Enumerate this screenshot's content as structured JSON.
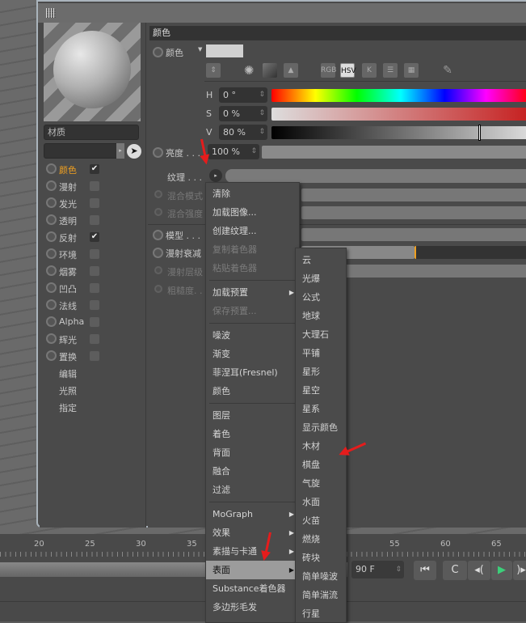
{
  "preview": {
    "material_name": "材质"
  },
  "channels": [
    {
      "label": "颜色",
      "checked": true,
      "active": true
    },
    {
      "label": "漫射",
      "checked": false
    },
    {
      "label": "发光",
      "checked": false
    },
    {
      "label": "透明",
      "checked": false
    },
    {
      "label": "反射",
      "checked": true
    },
    {
      "label": "环境",
      "checked": false
    },
    {
      "label": "烟雾",
      "checked": false
    },
    {
      "label": "凹凸",
      "checked": false
    },
    {
      "label": "法线",
      "checked": false
    },
    {
      "label": "Alpha",
      "checked": false
    },
    {
      "label": "辉光",
      "checked": false
    },
    {
      "label": "置换",
      "checked": false
    }
  ],
  "extra_items": [
    "编辑",
    "光照",
    "指定"
  ],
  "section_title": "颜色",
  "color": {
    "label": "颜色",
    "swatch": "#d0d0d0",
    "mode_buttons": [
      "RGB",
      "HSV",
      "K"
    ],
    "active_mode": "HSV",
    "h_label": "H",
    "h_value": "0 °",
    "s_label": "S",
    "s_value": "0 %",
    "v_label": "V",
    "v_value": "80 %",
    "v_fraction": 0.8
  },
  "brightness": {
    "label": "亮度 . . .",
    "value": "100 %"
  },
  "texture": {
    "label": "纹理 . . ."
  },
  "blend_mode": {
    "label": "混合模式"
  },
  "blend_strength": {
    "label": "混合强度"
  },
  "model": {
    "label": "模型 . . ."
  },
  "diffuse_falloff": {
    "label": "漫射衰减"
  },
  "diffuse_level": {
    "label": "漫射层级"
  },
  "roughness": {
    "label": "粗糙度. . ."
  },
  "menu": [
    {
      "label": "清除"
    },
    {
      "label": "加载图像..."
    },
    {
      "label": "创建纹理..."
    },
    {
      "label": "复制着色器",
      "disabled": true
    },
    {
      "label": "粘贴着色器",
      "disabled": true
    },
    {
      "sep": true
    },
    {
      "label": "加载预置",
      "submenu": true
    },
    {
      "label": "保存预置...",
      "disabled": true
    },
    {
      "sep": true
    },
    {
      "label": "噪波"
    },
    {
      "label": "渐变"
    },
    {
      "label": "菲涅耳(Fresnel)"
    },
    {
      "label": "颜色"
    },
    {
      "sep": true
    },
    {
      "label": "图层"
    },
    {
      "label": "着色"
    },
    {
      "label": "背面"
    },
    {
      "label": "融合"
    },
    {
      "label": "过滤"
    },
    {
      "sep": true
    },
    {
      "label": "MoGraph",
      "submenu": true
    },
    {
      "label": "效果",
      "submenu": true
    },
    {
      "label": "素描与卡通",
      "submenu": true
    },
    {
      "label": "表面",
      "submenu": true,
      "highlighted": true
    },
    {
      "label": "Substance着色器"
    },
    {
      "label": "多边形毛发"
    }
  ],
  "submenu": [
    "云",
    "光爆",
    "公式",
    "地球",
    "大理石",
    "平铺",
    "星形",
    "星空",
    "星系",
    "显示颜色",
    "木材",
    "棋盘",
    "气旋",
    "水面",
    "火苗",
    "燃烧",
    "砖块",
    "简单噪波",
    "简单湍流",
    "行星"
  ],
  "timeline": {
    "ticks": [
      "20",
      "25",
      "30",
      "35",
      "55",
      "60",
      "65"
    ],
    "end_frame": "90 F"
  },
  "colors": {
    "accent": "#f0a020",
    "highlight": "#9c9c9c",
    "arrow": "#e51c1c",
    "play": "#3ccf7a"
  }
}
